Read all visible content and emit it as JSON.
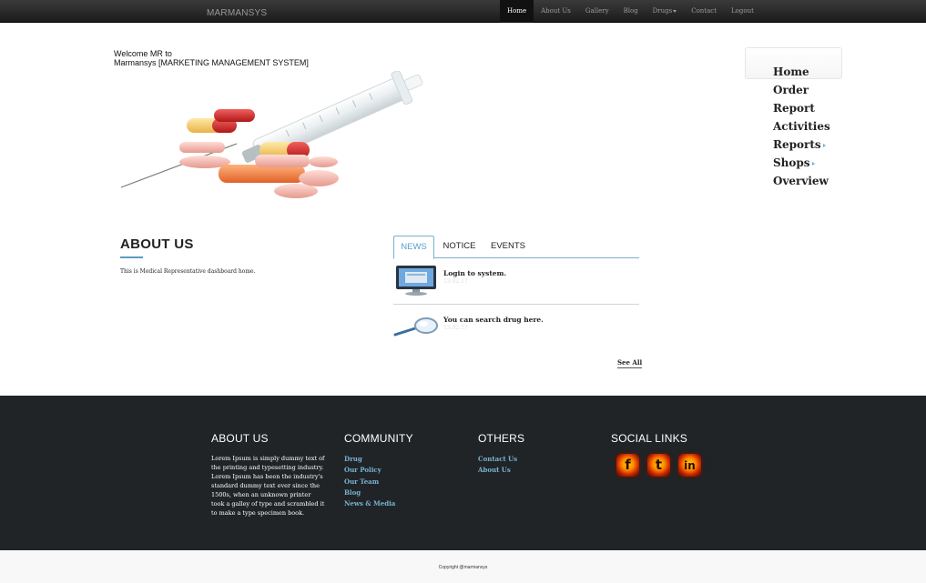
{
  "navbar": {
    "brand": "MARMANSYS",
    "items": [
      {
        "label": "Home",
        "active": true
      },
      {
        "label": "About Us"
      },
      {
        "label": "Gallery"
      },
      {
        "label": "Blog"
      },
      {
        "label": "Drugs",
        "dropdown": true
      },
      {
        "label": "Contact"
      },
      {
        "label": "Logout"
      }
    ]
  },
  "welcome": {
    "line1": "Welcome MR to",
    "line2": "Marmansys [MARKETING MANAGEMENT SYSTEM]"
  },
  "side_menu": {
    "items": [
      "Home",
      "Order",
      "Report",
      "Activities",
      "Reports",
      "Shops",
      "Overview"
    ]
  },
  "about": {
    "title": "ABOUT US",
    "text": "This is Medical Representative dashboard home."
  },
  "tabs": {
    "items": [
      "NEWS",
      "NOTICE",
      "EVENTS"
    ],
    "active": "NEWS"
  },
  "news": [
    {
      "title": "Login to system.",
      "date": "13.02.17",
      "icon": "monitor-icon"
    },
    {
      "title": "You can search drug here.",
      "date": "13.02.17",
      "icon": "magnifier-icon"
    }
  ],
  "see_all": "See All",
  "footer": {
    "about": {
      "title": "ABOUT US",
      "text": "Lorem Ipsum is simply dummy text of the printing and typesetting industry. Lorem Ipsum has been the industry's standard dummy text ever since the 1500s, when an unknown printer took a galley of type and scrambled it to make a type specimen book."
    },
    "community": {
      "title": "COMMUNITY",
      "links": [
        "Drug",
        "Our Policy",
        "Our Team",
        "Blog",
        "News & Media"
      ]
    },
    "others": {
      "title": "OTHERS",
      "links": [
        "Contact Us",
        "About Us"
      ]
    },
    "social": {
      "title": "SOCIAL LINKS",
      "icons": [
        "facebook-icon",
        "twitter-icon",
        "linkedin-icon"
      ],
      "glyphs": [
        "f",
        "t",
        "in"
      ]
    }
  },
  "copyright": "Copyright @marmansys",
  "colors": {
    "navbar": "#1c1c1c",
    "accent": "#5a9cc4",
    "link": "#7ab2d4",
    "footer": "#202426"
  }
}
